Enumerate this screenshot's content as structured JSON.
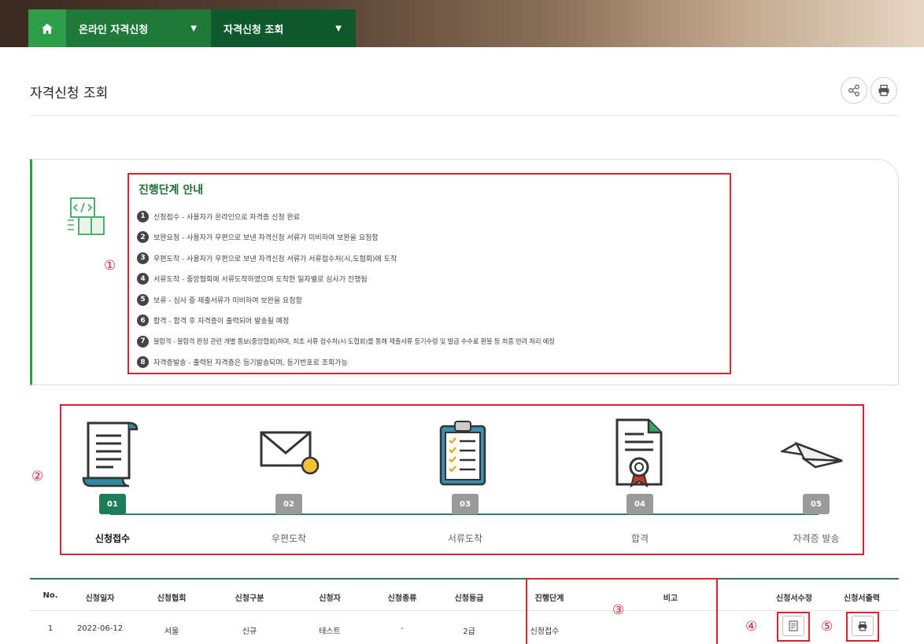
{
  "nav": {
    "home_icon": "home-icon",
    "menu1": "온라인 자격신청",
    "menu2": "자격신청 조회"
  },
  "page": {
    "title": "자격신청 조회",
    "share_icon": "share-icon",
    "print_icon": "print-icon"
  },
  "guide": {
    "title": "진행단계 안내",
    "items": [
      {
        "num": "1",
        "text": "신청접수 - 사용자가 온라인으로 자격증 신청 완료"
      },
      {
        "num": "2",
        "text": "보완요청 - 사용자가 우편으로 보낸 자격신청 서류가 미비하여 보완을 요청함"
      },
      {
        "num": "3",
        "text": "우편도착 - 사용자가 우편으로 보낸 자격신청 서류가 서류접수처(시,도협회)에 도착"
      },
      {
        "num": "4",
        "text": "서류도착 - 중앙협회에 서류도착하였으며 도착한 일자별로 심사가 진행됨"
      },
      {
        "num": "5",
        "text": "보류 - 심사 중 제출서류가 미비하여 보완을 요청함"
      },
      {
        "num": "6",
        "text": "합격 - 합격 후 자격증이 출력되어 발송될 예정"
      },
      {
        "num": "7",
        "text": "불합격 - 불합격 판정 관련 개별 통보(중앙협회)하며, 최초 서류 접수처(시·도협회)를 통해 제출서류 등기수령 및 발급 수수료 환불 등 최종 반려 처리 예정"
      },
      {
        "num": "8",
        "text": "자격증발송 - 출력된 자격증은 등기발송되며, 등기번호로 조회가능"
      }
    ]
  },
  "annotations": {
    "a1": "①",
    "a2": "②",
    "a3": "③",
    "a4": "④",
    "a5": "⑤"
  },
  "steps": [
    {
      "num": "01",
      "label": "신청접수",
      "icon": "scroll-document-icon"
    },
    {
      "num": "02",
      "label": "우편도착",
      "icon": "envelope-icon"
    },
    {
      "num": "03",
      "label": "서류도착",
      "icon": "clipboard-checklist-icon"
    },
    {
      "num": "04",
      "label": "합격",
      "icon": "certificate-icon"
    },
    {
      "num": "05",
      "label": "자격증 발송",
      "icon": "paper-plane-icon"
    }
  ],
  "table": {
    "headers": {
      "no": "No.",
      "date": "신청일자",
      "assoc": "신청협회",
      "type": "신청구분",
      "applicant": "신청자",
      "kind": "신청종류",
      "grade": "신청등급",
      "stage": "진행단계",
      "note": "비고",
      "edit": "신청서수정",
      "print": "신청서출력"
    },
    "rows": [
      {
        "no": "1",
        "date": "2022-06-12",
        "assoc": "서울",
        "type": "신규",
        "applicant": "테스트",
        "kind": "-",
        "grade": "2급",
        "stage": "신청접수",
        "note": "",
        "edit_icon": "document-edit-icon",
        "print_icon": "print-icon"
      }
    ]
  }
}
